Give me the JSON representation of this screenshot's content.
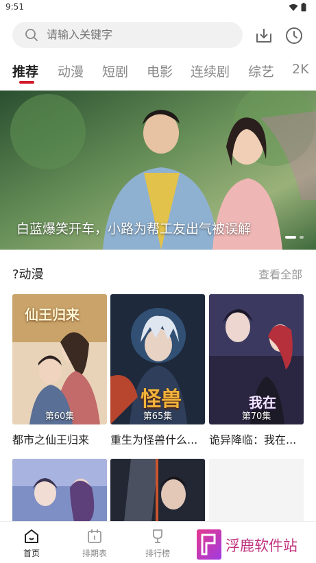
{
  "status_bar": {
    "time": "9:51"
  },
  "search": {
    "placeholder": "请输入关键字"
  },
  "tabs": [
    {
      "label": "推荐",
      "active": true
    },
    {
      "label": "动漫"
    },
    {
      "label": "短剧"
    },
    {
      "label": "电影"
    },
    {
      "label": "连续剧"
    },
    {
      "label": "综艺"
    },
    {
      "label": "2K"
    }
  ],
  "banner": {
    "caption": "白蓝爆笑开车，小路为帮工友出气被误解"
  },
  "section": {
    "title": "?动漫",
    "more": "查看全部"
  },
  "cards": [
    {
      "title": "都市之仙王归来",
      "episode": "第60集",
      "poster_text": "仙王归来"
    },
    {
      "title": "重生为怪兽什么...",
      "episode": "第65集",
      "poster_text": "怪兽"
    },
    {
      "title": "诡异降临：我在...",
      "episode": "第70集",
      "poster_text": "我在"
    }
  ],
  "bottom_nav": [
    {
      "label": "首页",
      "icon": "home-icon",
      "active": true
    },
    {
      "label": "排期表",
      "icon": "calendar-icon"
    },
    {
      "label": "排行榜",
      "icon": "trophy-icon"
    }
  ],
  "watermark": {
    "text": "浮鹿软件站"
  },
  "colors": {
    "accent": "#d31a2c",
    "banner": "#4f7748"
  }
}
